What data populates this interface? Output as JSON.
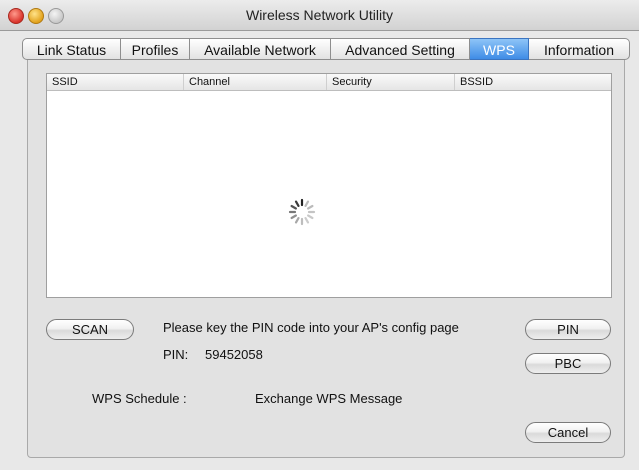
{
  "window": {
    "title": "Wireless Network Utility"
  },
  "tabs": [
    {
      "label": "Link Status",
      "active": false
    },
    {
      "label": "Profiles",
      "active": false
    },
    {
      "label": "Available Network",
      "active": false
    },
    {
      "label": "Advanced Setting",
      "active": false
    },
    {
      "label": "WPS",
      "active": true
    },
    {
      "label": "Information",
      "active": false
    }
  ],
  "table": {
    "columns": [
      "SSID",
      "Channel",
      "Security",
      "BSSID"
    ],
    "rows": [],
    "loading_icon": "spinner-icon"
  },
  "wps": {
    "scan_label": "SCAN",
    "message": "Please key the PIN code into your AP's config page",
    "pin_label": "PIN:",
    "pin_value": "59452058",
    "pin_button": "PIN",
    "pbc_button": "PBC",
    "schedule_label": "WPS Schedule :",
    "schedule_value": "Exchange WPS Message",
    "cancel_button": "Cancel"
  },
  "colors": {
    "active_tab": "#4a93e8",
    "window_bg": "#e8e8e8"
  }
}
